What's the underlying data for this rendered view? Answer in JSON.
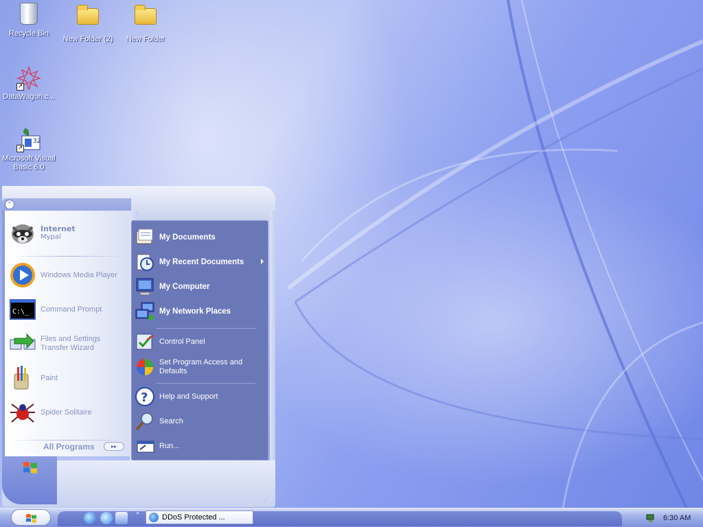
{
  "desktop": {
    "icons": [
      {
        "label": "Recycle Bin"
      },
      {
        "label": "New Folder (2)"
      },
      {
        "label": "New Folder"
      },
      {
        "label": "DataWagon.c..."
      },
      {
        "label": "Microsoft Visual Basic 6.0"
      }
    ]
  },
  "start_menu": {
    "pinned": {
      "title": "Internet",
      "subtitle": "Mypal"
    },
    "recent_programs": [
      {
        "label": "Windows Media Player"
      },
      {
        "label": "Command Prompt"
      },
      {
        "label": "Files and Settings Transfer Wizard"
      },
      {
        "label": "Paint"
      },
      {
        "label": "Spider Solitaire"
      }
    ],
    "all_programs_label": "All Programs",
    "places": [
      {
        "label": "My Documents"
      },
      {
        "label": "My Recent Documents"
      },
      {
        "label": "My Computer"
      },
      {
        "label": "My Network Places"
      }
    ],
    "settings": [
      {
        "label": "Control Panel"
      },
      {
        "label": "Set Program Access and Defaults"
      }
    ],
    "tools": [
      {
        "label": "Help and Support"
      },
      {
        "label": "Search"
      },
      {
        "label": "Run..."
      }
    ]
  },
  "taskbar": {
    "task_buttons": [
      {
        "label": "DDoS Protected ..."
      }
    ],
    "clock": "6:30 AM"
  },
  "colors": {
    "start_menu_right_pane": "#6b78b8",
    "taskbar": "#8093dc",
    "desktop_background": "#8ea0ea"
  }
}
